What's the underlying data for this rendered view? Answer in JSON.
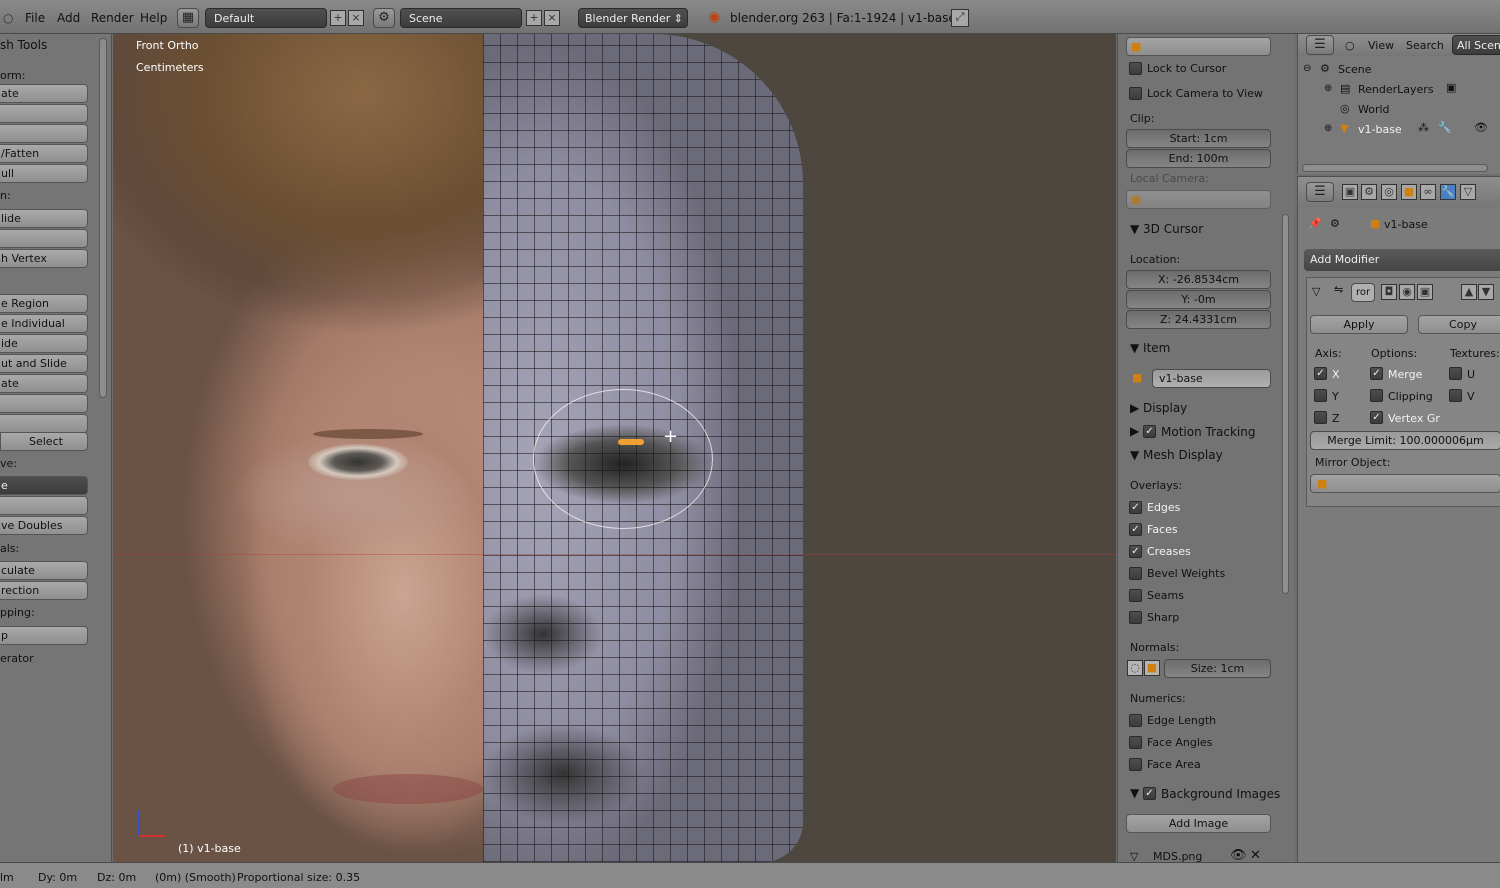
{
  "menu": {
    "file": "File",
    "add": "Add",
    "render": "Render",
    "help": "Help"
  },
  "header": {
    "layout": "Default",
    "scene": "Scene",
    "engine": "Blender Render",
    "info": "blender.org 263 | Fa:1-1924 | v1-base"
  },
  "toolshelf": {
    "title": "sh Tools",
    "items": [
      {
        "type": "label",
        "text": "orm:"
      },
      {
        "type": "btn",
        "text": "ate"
      },
      {
        "type": "btn",
        "text": ""
      },
      {
        "type": "btn",
        "text": ""
      },
      {
        "type": "btn",
        "text": "/Fatten"
      },
      {
        "type": "btn",
        "text": "ull"
      },
      {
        "type": "label",
        "text": "n:"
      },
      {
        "type": "btn",
        "text": "lide"
      },
      {
        "type": "btn",
        "text": ""
      },
      {
        "type": "btn",
        "text": "h Vertex"
      },
      {
        "type": "btn",
        "text": "e Region"
      },
      {
        "type": "btn",
        "text": "e Individual"
      },
      {
        "type": "btn",
        "text": "ide"
      },
      {
        "type": "btn",
        "text": "ut and Slide"
      },
      {
        "type": "btn",
        "text": "ate"
      },
      {
        "type": "btn",
        "text": ""
      },
      {
        "type": "btn",
        "text": ""
      },
      {
        "type": "btn",
        "text": "Select"
      },
      {
        "type": "label",
        "text": "ve:"
      },
      {
        "type": "btn",
        "text": "e"
      },
      {
        "type": "btn",
        "text": ""
      },
      {
        "type": "btn",
        "text": "ve Doubles"
      },
      {
        "type": "label",
        "text": "als:"
      },
      {
        "type": "btn",
        "text": "culate"
      },
      {
        "type": "btn",
        "text": "rection"
      },
      {
        "type": "label",
        "text": "pping:"
      },
      {
        "type": "btn",
        "text": "p"
      },
      {
        "type": "label",
        "text": "erator"
      }
    ]
  },
  "viewport": {
    "view": "Front Ortho",
    "units": "Centimeters",
    "object": "(1) v1-base"
  },
  "npanel": {
    "lock_cursor": "Lock to Cursor",
    "lock_camera": "Lock Camera to View",
    "clip": "Clip:",
    "clip_start": "Start: 1cm",
    "clip_end": "End: 100m",
    "local_camera": "Local Camera:",
    "cursor_head": "3D Cursor",
    "location": "Location:",
    "loc_x": "X: -26.8534cm",
    "loc_y": "Y: -0m",
    "loc_z": "Z: 24.4331cm",
    "item_head": "Item",
    "item_name": "v1-base",
    "display_head": "Display",
    "motion_tracking": "Motion Tracking",
    "mesh_display": "Mesh Display",
    "overlays": "Overlays:",
    "edges": "Edges",
    "faces": "Faces",
    "creases": "Creases",
    "bevel_weights": "Bevel Weights",
    "seams": "Seams",
    "sharp": "Sharp",
    "normals": "Normals:",
    "normal_size": "Size: 1cm",
    "numerics": "Numerics:",
    "edge_length": "Edge Length",
    "face_angles": "Face Angles",
    "face_area": "Face Area",
    "bg_images": "Background Images",
    "add_image": "Add Image",
    "image_file": "MDS.png"
  },
  "outliner": {
    "view": "View",
    "search": "Search",
    "all_scenes": "All Scene",
    "scene": "Scene",
    "render_layers": "RenderLayers",
    "world": "World",
    "object": "v1-base"
  },
  "properties": {
    "object": "v1-base",
    "add_modifier": "Add Modifier",
    "modifier_name": "ror",
    "apply": "Apply",
    "copy": "Copy",
    "axis": "Axis:",
    "options": "Options:",
    "textures": "Textures:",
    "x": "X",
    "y": "Y",
    "z": "Z",
    "merge": "Merge",
    "clipping": "Clipping",
    "vertex_gr": "Vertex Gr",
    "u": "U",
    "v": "V",
    "merge_limit": "Merge Limit: 100.000006µm",
    "mirror_object": "Mirror Object:"
  },
  "status": {
    "dx": "lm",
    "dy": "Dy: 0m",
    "dz": "Dz: 0m",
    "smooth": "(0m) (Smooth)",
    "prop": "Proportional size: 0.35"
  }
}
